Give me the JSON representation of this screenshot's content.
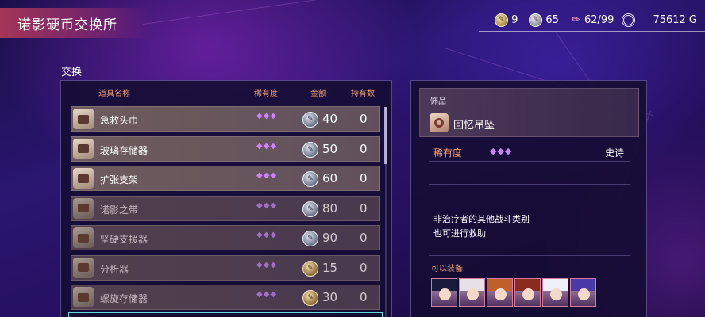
{
  "header": {
    "title": "诺影硬币交换所",
    "resources": [
      {
        "icon": "gold-coin-icon",
        "value": "9"
      },
      {
        "icon": "silver-coin-icon",
        "value": "65"
      },
      {
        "icon": "pen-icon",
        "value": "62/99"
      },
      {
        "icon": "gold-currency-icon",
        "value": "75612 G"
      }
    ]
  },
  "exchange": {
    "section_label": "交换",
    "columns": {
      "name": "道具名称",
      "rarity": "稀有度",
      "price": "金额",
      "owned": "持有数"
    },
    "items": [
      {
        "name": "急救头巾",
        "rarity": "◆◆◆",
        "coin": "silver",
        "price": "40",
        "owned": "0",
        "dim": false
      },
      {
        "name": "玻璃存储器",
        "rarity": "◆◆◆",
        "coin": "silver",
        "price": "50",
        "owned": "0",
        "dim": false
      },
      {
        "name": "扩张支架",
        "rarity": "◆◆◆",
        "coin": "silver",
        "price": "60",
        "owned": "0",
        "dim": false
      },
      {
        "name": "诺影之带",
        "rarity": "◆◆◆",
        "coin": "silver",
        "price": "80",
        "owned": "0",
        "dim": true
      },
      {
        "name": "坚硬支援器",
        "rarity": "◆◆◆",
        "coin": "silver",
        "price": "90",
        "owned": "0",
        "dim": true
      },
      {
        "name": "分析器",
        "rarity": "◆◆◆",
        "coin": "gold",
        "price": "15",
        "owned": "0",
        "dim": true
      },
      {
        "name": "螺旋存储器",
        "rarity": "◆◆◆",
        "coin": "gold",
        "price": "30",
        "owned": "0",
        "dim": true
      }
    ]
  },
  "detail": {
    "category": "饰品",
    "name": "回忆吊坠",
    "rarity_label": "稀有度",
    "rarity": "◆◆◆",
    "rarity_value": "史诗",
    "description_line1": "非治疗者的其他战斗类别",
    "description_line2": "也可进行救助",
    "equip_label": "可以装备"
  },
  "colors": {
    "accent": "#f0a070",
    "rarity": "#d080ff",
    "title_bar": "#be3c5a",
    "selection": "#5ae0d8"
  }
}
